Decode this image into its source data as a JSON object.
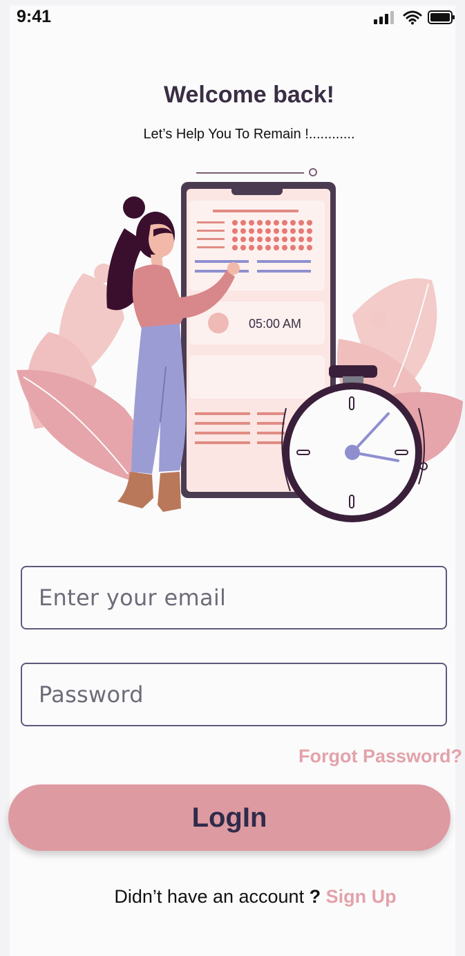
{
  "status_bar": {
    "time": "9:41",
    "signal_icon": "signal-icon",
    "wifi_icon": "wifi-icon",
    "battery_icon": "battery-icon"
  },
  "header": {
    "title": "Welcome back!",
    "subtitle": "Let’s Help You To Remain !............"
  },
  "illustration": {
    "clock_time": "05:00 AM"
  },
  "form": {
    "email_placeholder": "Enter your email",
    "password_placeholder": "Password",
    "forgot_label": "Forgot Password?",
    "login_label": "LogIn"
  },
  "footer": {
    "prompt": "Didn’t have an account",
    "question_mark": "?",
    "signup_label": "Sign Up"
  },
  "colors": {
    "accent": "#de9aa1",
    "link": "#e3a2a9",
    "heading": "#3a2e44",
    "border": "#5b5a7c"
  }
}
